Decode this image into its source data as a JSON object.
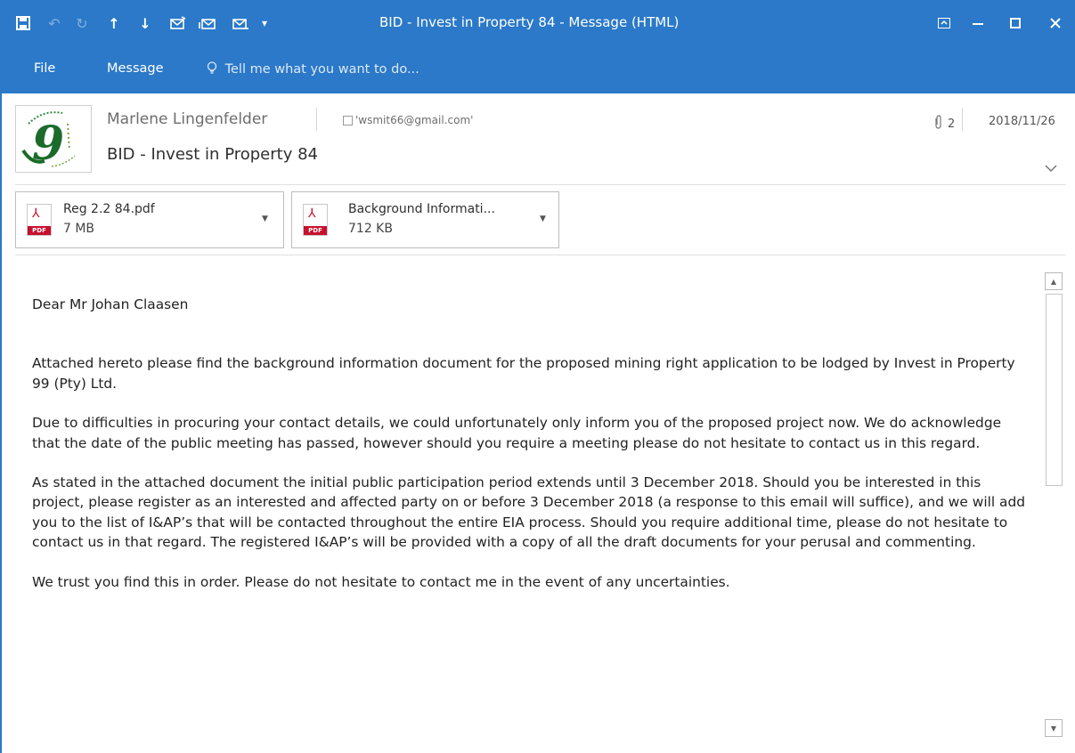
{
  "window": {
    "title": "BID - Invest in Property 84 - Message (HTML)"
  },
  "quick_access": [
    {
      "icon": "save-icon",
      "glyph": "🖫"
    },
    {
      "icon": "undo-icon",
      "glyph": "↶"
    },
    {
      "icon": "redo-icon",
      "glyph": "↻"
    },
    {
      "icon": "previous-item-icon",
      "glyph": "🡑"
    },
    {
      "icon": "next-item-icon",
      "glyph": "🡓"
    },
    {
      "icon": "reply-icon",
      "glyph": "✉"
    },
    {
      "icon": "reply-all-icon",
      "glyph": "✉"
    },
    {
      "icon": "forward-icon",
      "glyph": "✉"
    },
    {
      "icon": "customize-dropdown-icon",
      "glyph": "▾"
    }
  ],
  "ribbon": {
    "tabs": [
      "File",
      "Message"
    ],
    "tell_me": "Tell me what you want to do..."
  },
  "message": {
    "sender": "Marlene Lingenfelder",
    "to": "'wsmit66@gmail.com'",
    "subject": "BID - Invest in Property 84",
    "attachment_count": "2",
    "date": "2018/11/26"
  },
  "attachments": [
    {
      "name": "Reg 2.2 84.pdf",
      "size": "7 MB",
      "icon": "pdf-icon"
    },
    {
      "name": "Background Informati...",
      "size": "712 KB",
      "icon": "pdf-icon"
    }
  ],
  "body": {
    "paragraphs": [
      "Dear Mr Johan Claasen",
      "Attached hereto please find the background information document for the proposed mining right application to be lodged by Invest in Property 99 (Pty) Ltd.",
      "Due to difficulties in procuring your contact details, we could unfortunately only inform you of the proposed project now.  We do acknowledge that the date of the public meeting has passed, however should you require a meeting please do not hesitate to contact us in this regard.",
      "As stated in the attached document the initial public participation period extends until 3 December 2018.  Should you be interested in this project, please register as an interested and affected party on or before 3 December 2018 (a response to this email will suffice), and we will add you to the list of I&AP’s that will be contacted throughout the entire EIA process.  Should you require additional time, please do not hesitate to contact us in that regard.  The registered I&AP’s will be provided with a copy of all the draft documents for your perusal and commenting.",
      "We trust you find this in order.  Please do not hesitate to contact me in the event of any uncertainties."
    ]
  },
  "colors": {
    "titlebar": "#2b79c8",
    "pdf_red": "#c8102e"
  }
}
